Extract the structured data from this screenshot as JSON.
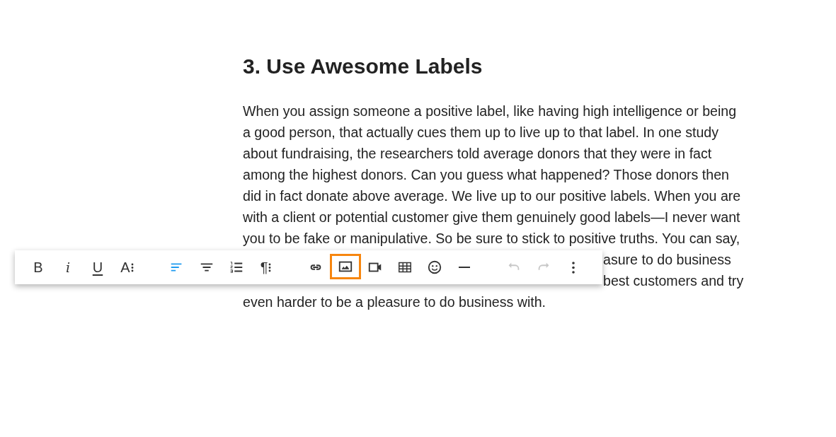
{
  "article": {
    "heading": "3. Use Awesome Labels",
    "lines": [
      {
        "text": "When you assign someone a positive label, like having high intelligence or being",
        "covered": false
      },
      {
        "text": "a good person, that actually cues them up to live up to that label. In one study",
        "covered": false
      },
      {
        "text": "about fundraising, the researchers told average donors that they were in fact",
        "covered": false
      },
      {
        "text": "among the highest donors. Can you guess what happened? Those donors then",
        "covered": false
      },
      {
        "text": "did in fact donate above average. We live up to our positive labels. When you are",
        "covered": false
      },
      {
        "text": "with a client or potential customer give them genuinely good labels—I never want",
        "covered": false
      },
      {
        "text": "you to be fake or manipulative. So be sure to stick to positive truths. You can say,",
        "covered": false
      },
      {
        "text": "asure to do business",
        "covered": true
      },
      {
        "text": "best customers and try",
        "covered": true
      },
      {
        "text": "even harder to be a pleasure to do business with.",
        "covered": false
      }
    ]
  },
  "toolbar": {
    "groups": [
      [
        {
          "kind": "bold",
          "label": "B",
          "disabled": false,
          "highlighted": false
        },
        {
          "kind": "italic",
          "label": "i",
          "disabled": false,
          "highlighted": false
        },
        {
          "kind": "underline",
          "label": "U",
          "disabled": false,
          "highlighted": false
        },
        {
          "kind": "text-menu",
          "label": "A",
          "disabled": false,
          "highlighted": false
        }
      ],
      [
        {
          "kind": "align-left",
          "selected": true,
          "disabled": false,
          "highlighted": false
        },
        {
          "kind": "align-center",
          "selected": false,
          "disabled": false,
          "highlighted": false
        },
        {
          "kind": "numbered-list",
          "disabled": false,
          "highlighted": false
        },
        {
          "kind": "text-menu",
          "label": "¶",
          "disabled": false,
          "highlighted": false
        }
      ],
      [
        {
          "kind": "link",
          "disabled": false,
          "highlighted": false
        },
        {
          "kind": "image",
          "disabled": false,
          "highlighted": true
        },
        {
          "kind": "video",
          "disabled": false,
          "highlighted": false
        },
        {
          "kind": "table",
          "disabled": false,
          "highlighted": false
        },
        {
          "kind": "emoji",
          "disabled": false,
          "highlighted": false
        },
        {
          "kind": "rule",
          "disabled": false,
          "highlighted": false
        }
      ],
      [
        {
          "kind": "undo",
          "disabled": true,
          "highlighted": false
        },
        {
          "kind": "redo",
          "disabled": true,
          "highlighted": false
        },
        {
          "kind": "more",
          "disabled": false,
          "highlighted": false
        }
      ]
    ]
  }
}
